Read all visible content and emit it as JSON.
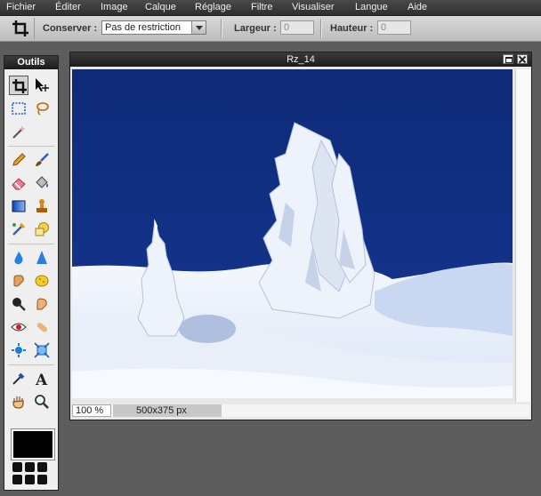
{
  "menu": {
    "items": [
      "Fichier",
      "Éditer",
      "Image",
      "Calque",
      "Réglage",
      "Filtre",
      "Visualiser",
      "Langue",
      "Aide"
    ]
  },
  "options": {
    "tool_icon": "crop-icon",
    "keep_label": "Conserver :",
    "keep_value": "Pas de restriction",
    "width_label": "Largeur :",
    "width_value": "0",
    "height_label": "Hauteur :",
    "height_value": "0"
  },
  "tools": {
    "title": "Outils",
    "icons": [
      "crop-icon",
      "move-icon",
      "marquee-select-icon",
      "lasso-icon",
      "magic-wand-icon",
      "pencil-icon",
      "brush-icon",
      "eraser-icon",
      "paint-bucket-icon",
      "gradient-icon",
      "clone-stamp-icon",
      "color-replace-icon",
      "shape-icon",
      "blur-drop-icon",
      "sharpen-icon",
      "smudge-icon",
      "sponge-icon",
      "burn-icon",
      "dodge-icon",
      "red-eye-icon",
      "spot-heal-icon",
      "bloat-icon",
      "pinch-icon",
      "color-picker-icon",
      "text-icon",
      "hand-icon",
      "zoom-icon"
    ],
    "primary_color": "#000000"
  },
  "image_window": {
    "title": "Rz_14",
    "zoom": "100 %",
    "dimensions": "500x375 px"
  },
  "colors": {
    "sky": "#13307f",
    "snow": "#eef3fb",
    "workspace": "#5d5d5d"
  }
}
